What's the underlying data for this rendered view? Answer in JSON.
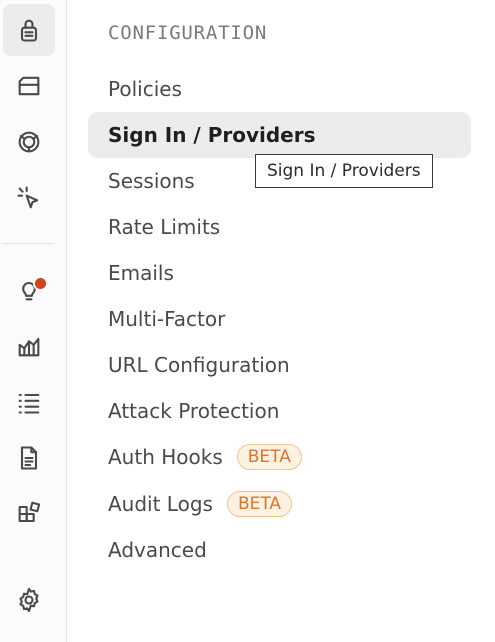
{
  "sidebar_rail": {
    "icons": [
      {
        "name": "lock-icon",
        "active": true
      },
      {
        "name": "database-icon"
      },
      {
        "name": "network-icon"
      },
      {
        "name": "cursor-click-icon"
      },
      {
        "name": "lightbulb-icon",
        "notification": true
      },
      {
        "name": "reports-chart-icon"
      },
      {
        "name": "logs-list-icon"
      },
      {
        "name": "document-icon"
      },
      {
        "name": "integrations-blocks-icon"
      },
      {
        "name": "gear-icon"
      }
    ],
    "notification_color": "#d1431a"
  },
  "section": {
    "title": "CONFIGURATION"
  },
  "menu": [
    {
      "label": "Policies"
    },
    {
      "label": "Sign In / Providers",
      "active": true
    },
    {
      "label": "Sessions"
    },
    {
      "label": "Rate Limits"
    },
    {
      "label": "Emails"
    },
    {
      "label": "Multi-Factor"
    },
    {
      "label": "URL Configuration"
    },
    {
      "label": "Attack Protection"
    },
    {
      "label": "Auth Hooks",
      "badge": "BETA"
    },
    {
      "label": "Audit Logs",
      "badge": "BETA"
    },
    {
      "label": "Advanced"
    }
  ],
  "tooltip": {
    "text": "Sign In / Providers"
  },
  "colors": {
    "active_bg": "#ececec",
    "badge_text": "#d8772a",
    "badge_bg": "#fdf1e4"
  }
}
